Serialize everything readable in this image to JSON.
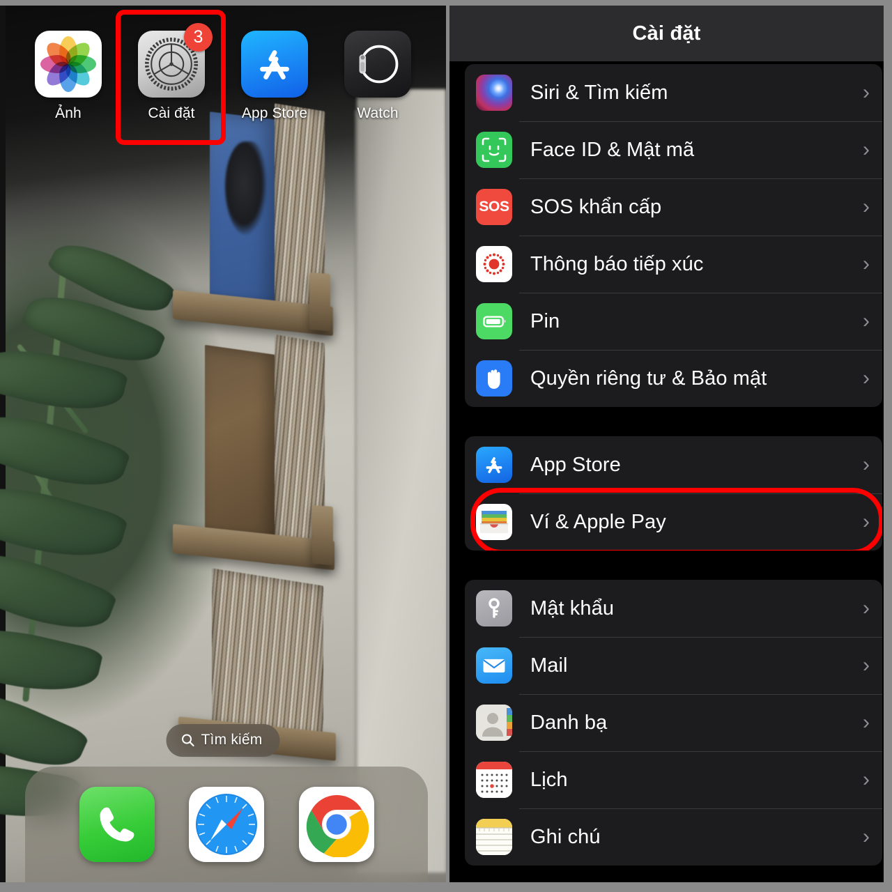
{
  "home": {
    "apps": [
      {
        "label": "Ảnh",
        "icon": "photos-icon",
        "badge": null
      },
      {
        "label": "Cài đặt",
        "icon": "settings-gear-icon",
        "badge": "3"
      },
      {
        "label": "App Store",
        "icon": "app-store-icon",
        "badge": null
      },
      {
        "label": "Watch",
        "icon": "watch-icon",
        "badge": null
      }
    ],
    "search": {
      "label": "Tìm kiếm",
      "icon": "search-icon"
    },
    "dock": [
      {
        "name": "Phone",
        "icon": "phone-icon"
      },
      {
        "name": "Safari",
        "icon": "safari-compass-icon"
      },
      {
        "name": "Chrome",
        "icon": "chrome-icon"
      }
    ]
  },
  "settings": {
    "title": "Cài đặt",
    "chevron": "›",
    "groups": [
      {
        "rows": [
          {
            "label": "Siri & Tìm kiếm",
            "icon": "siri-icon"
          },
          {
            "label": "Face ID & Mật mã",
            "icon": "face-id-icon"
          },
          {
            "label": "SOS khẩn cấp",
            "icon": "sos-icon",
            "icon_text": "SOS"
          },
          {
            "label": "Thông báo tiếp xúc",
            "icon": "exposure-notification-icon"
          },
          {
            "label": "Pin",
            "icon": "battery-icon"
          },
          {
            "label": "Quyền riêng tư & Bảo mật",
            "icon": "privacy-hand-icon"
          }
        ]
      },
      {
        "rows": [
          {
            "label": "App Store",
            "icon": "app-store-icon"
          },
          {
            "label": "Ví & Apple Pay",
            "icon": "wallet-icon",
            "highlighted": true
          }
        ]
      },
      {
        "rows": [
          {
            "label": "Mật khẩu",
            "icon": "password-key-icon"
          },
          {
            "label": "Mail",
            "icon": "mail-envelope-icon"
          },
          {
            "label": "Danh bạ",
            "icon": "contacts-icon"
          },
          {
            "label": "Lịch",
            "icon": "calendar-icon"
          },
          {
            "label": "Ghi chú",
            "icon": "notes-icon"
          }
        ]
      }
    ]
  },
  "annotation": {
    "highlight_color": "#ff0000",
    "targets": [
      "Cài đặt app icon",
      "Ví & Apple Pay row"
    ]
  }
}
